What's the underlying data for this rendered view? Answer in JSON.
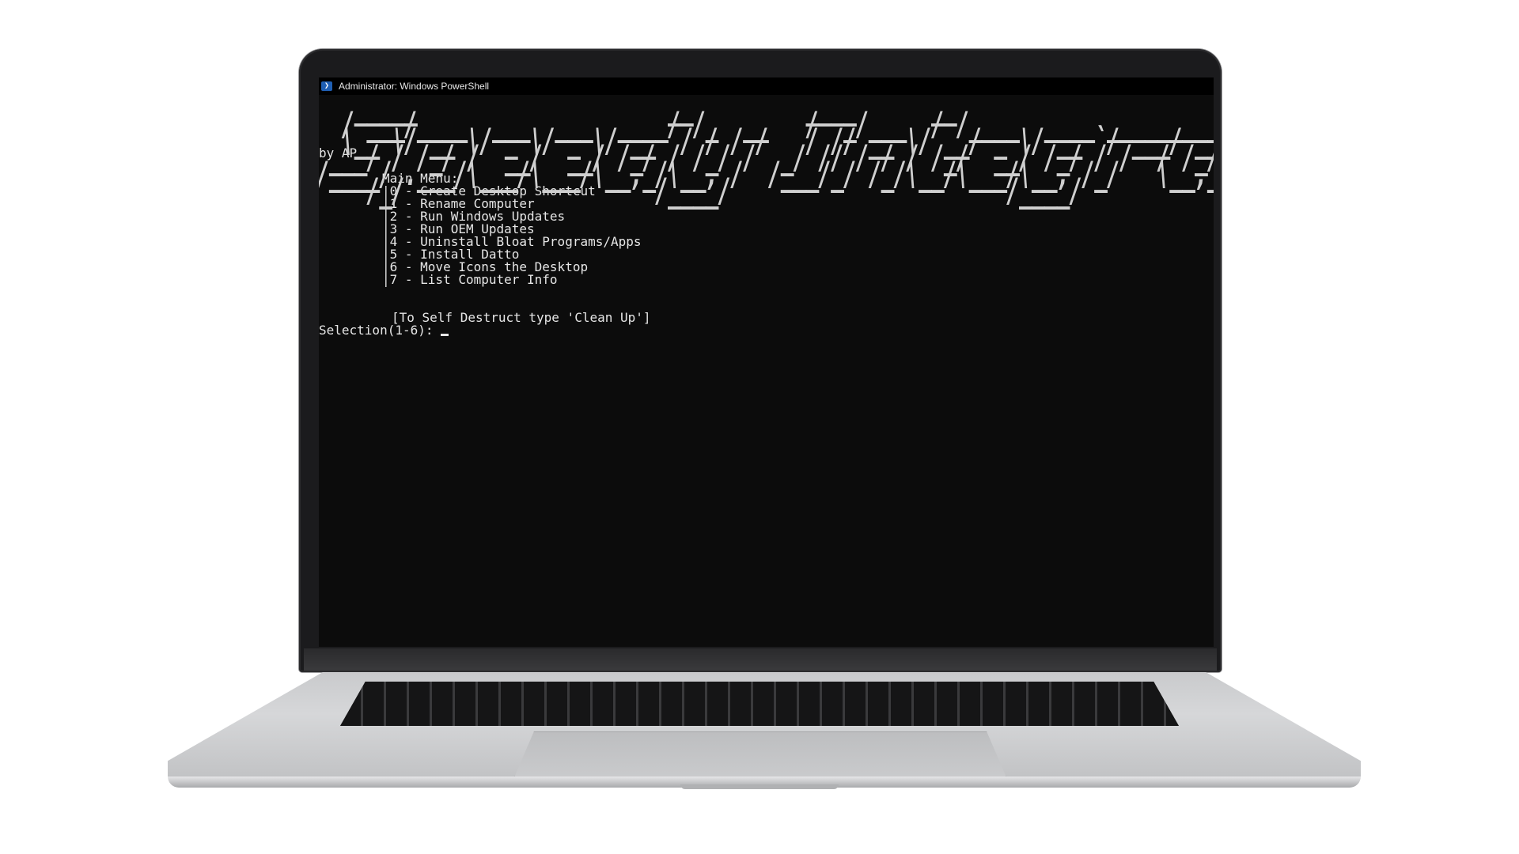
{
  "window": {
    "title": "Administrator: Windows PowerShell",
    "icon": "powershell-icon"
  },
  "console": {
    "banner_lines": [
      "   _____                    __         ____      __                        __  _                ______            __",
      "  / ___/____  ___  ___  ____/ /_  __   /  _/___  / /____  ____ __________ _/ /_(_)___  ____     /_  __/___  ____  / /",
      "  \\__ \\/ __ \\/ _ \\/ _ \\/ __  / / / /   / // __ \\/ __/ _ \\/ __ `/ ___/ __ `/ __/ / __ \\/ __ \\     / / / __ \\/ __ \\/ / ",
      " ___/ / /_/ /  __/  __/ /_/ / /_/ /  _/ // / / / /_/  __/ /_/ / /  / /_/ / /_/ / /_/ / / / /    / / / /_/ / /_/ / /  ",
      "/____/ .___/\\___/\\___/\\__,_/\\__, /  /___/_/ /_/\\__/\\___/\\__, /_/   \\__,_/\\__/_/\\____/_/ /_/    /_/  \\____/\\____/_/   ",
      "    /_/                    /____/                      /____/                                                        "
    ],
    "author": "by AP",
    "menu_title": "Main Menu:",
    "menu_items": [
      "|0 - Create Desktop Shortcut",
      "|1 - Rename Computer",
      "|2 - Run Windows Updates",
      "|3 - Run OEM Updates",
      "|4 - Uninstall Bloat Programs/Apps",
      "|5 - Install Datto",
      "|6 - Move Icons the Desktop",
      "|7 - List Computer Info"
    ],
    "self_destruct_note": "[To Self Destruct type 'Clean Up']",
    "prompt": "Selection(1-6):"
  },
  "colors": {
    "console_bg": "#0c0c0c",
    "console_fg": "#e6e6e6",
    "titlebar_bg": "#000000",
    "powershell_blue": "#1f5fb4"
  }
}
